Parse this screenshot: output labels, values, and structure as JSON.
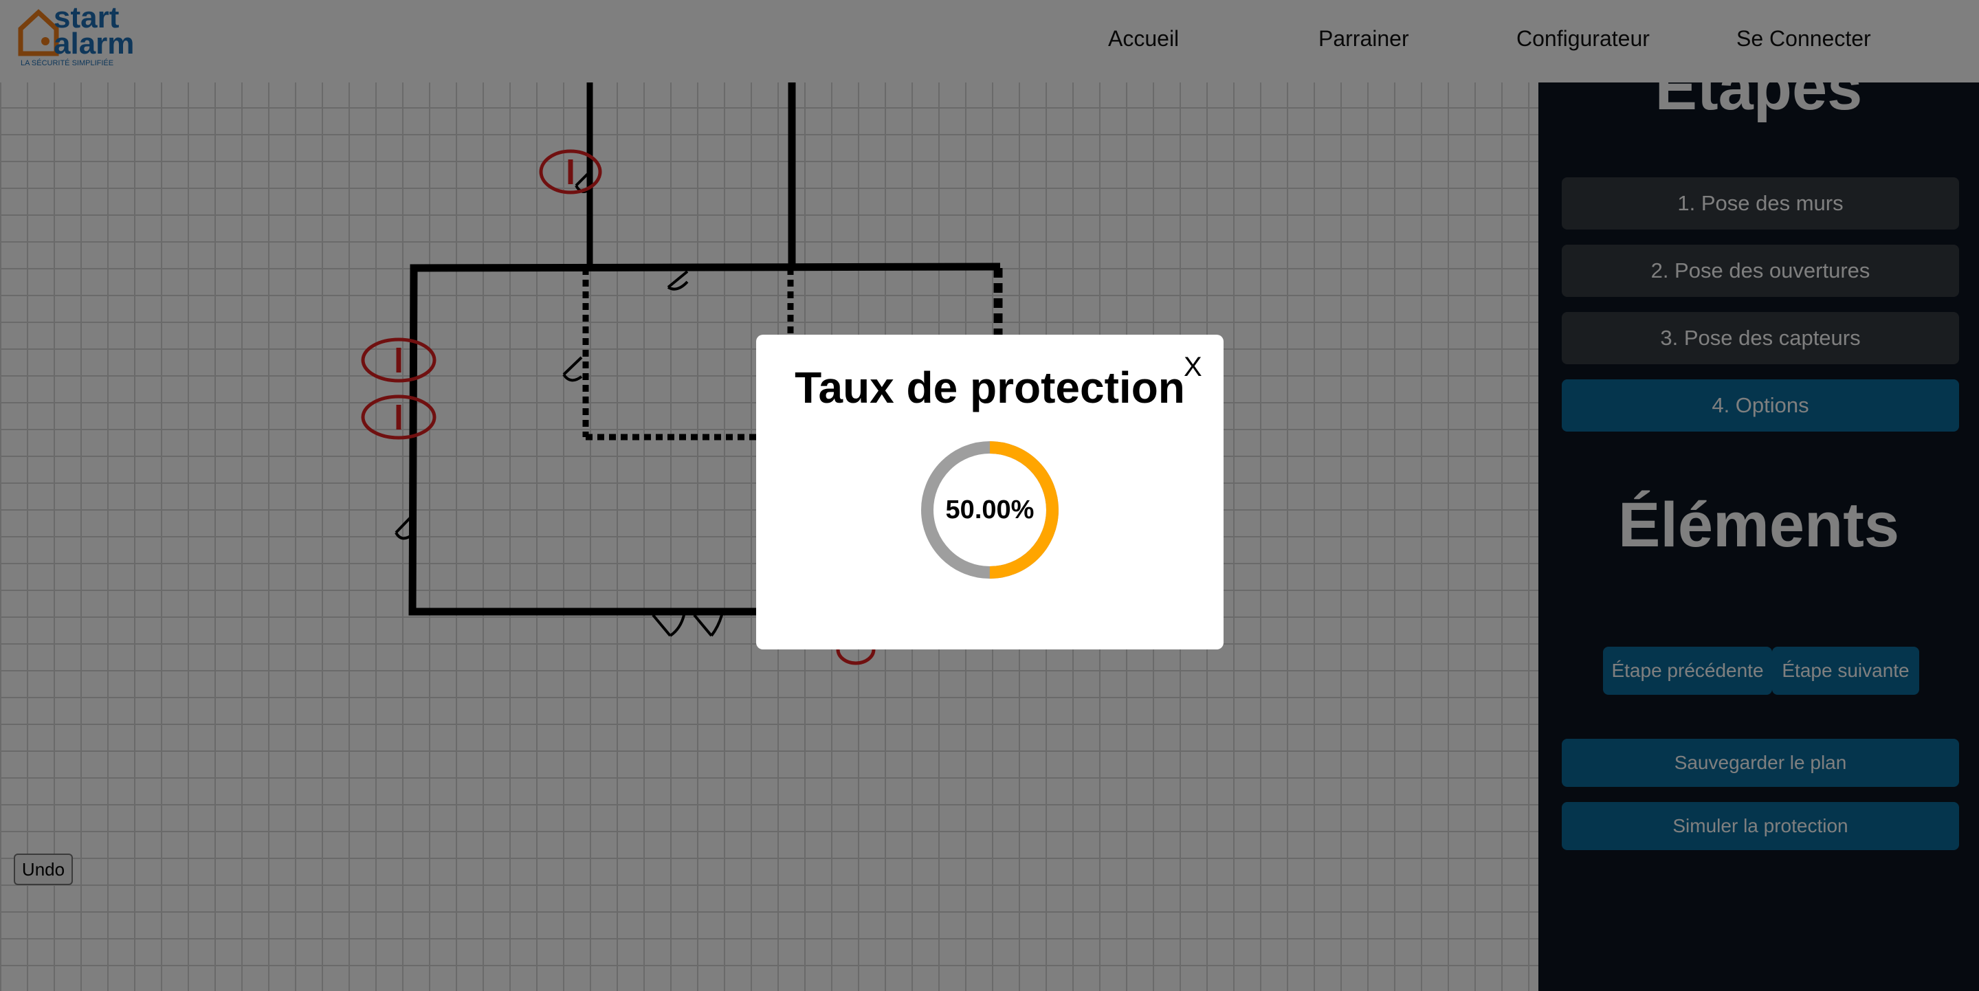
{
  "brand": {
    "name_top": "start",
    "name_bottom": "alarm",
    "tagline": "LA SÉCURITÉ SIMPLIFIÉE"
  },
  "nav": {
    "items": [
      "Accueil",
      "Parrainer",
      "Configurateur",
      "Se Connecter"
    ]
  },
  "sidebar": {
    "steps_title": "Étapes",
    "steps": [
      "1. Pose des murs",
      "2. Pose des ouvertures",
      "3. Pose des capteurs",
      "4. Options"
    ],
    "active_step": 4,
    "elements_title": "Éléments",
    "prev_label": "Étape précédente",
    "next_label": "Étape suivante",
    "save_label": "Sauvegarder le plan",
    "simulate_label": "Simuler la protection"
  },
  "canvas": {
    "undo_label": "Undo"
  },
  "modal": {
    "title": "Taux de protection",
    "close_label": "X",
    "protection_text": "50.00%",
    "protection_value": 0.5,
    "colors": {
      "filled": "#ffa500",
      "remaining": "#9e9e9e"
    }
  },
  "colors": {
    "accent": "#0b6b9a",
    "logo_orange": "#f07f1b",
    "logo_blue": "#1e6fb5",
    "sensor_red": "#e02020"
  }
}
